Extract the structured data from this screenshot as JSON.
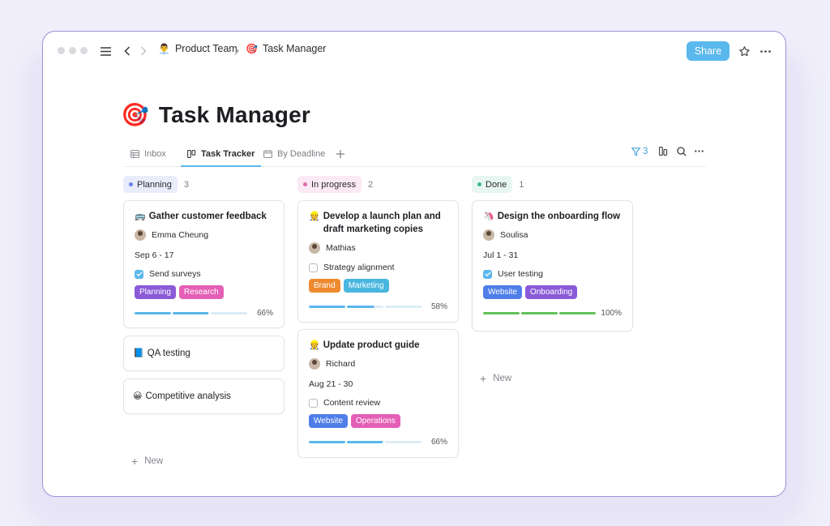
{
  "header": {
    "breadcrumb": [
      {
        "label": "Product Team",
        "emoji": "👨‍💼"
      },
      {
        "label": "Task Manager",
        "emoji": "🎯"
      }
    ],
    "share_label": "Share"
  },
  "page": {
    "title": "Task Manager",
    "emoji": "🎯"
  },
  "tabs": [
    {
      "label": "Inbox",
      "icon": "table-icon"
    },
    {
      "label": "Task Tracker",
      "icon": "board-icon",
      "active": true
    },
    {
      "label": "By Deadline",
      "icon": "calendar-icon"
    }
  ],
  "filter": {
    "count": "3"
  },
  "columns": [
    {
      "label": "Planning",
      "count": "3",
      "bg": "#e9ecfb",
      "dot": "#6a84e8",
      "cards": [
        {
          "title": "Gather customer feedback",
          "emoji": "🚌",
          "assignee": "Emma Cheung",
          "date": "Sep 6 - 17",
          "checklist": {
            "label": "Send surveys",
            "checked": true
          },
          "tags": [
            {
              "label": "Planning",
              "color": "#8a5ad8"
            },
            {
              "label": "Research",
              "color": "#e45fb5"
            }
          ],
          "progress_pct": "66%",
          "progress_color": "#5ab8ec",
          "progress": 0.66
        },
        {
          "title": "QA testing",
          "emoji": "📘"
        },
        {
          "title": "Competitive analysis",
          "emoji": "😀"
        }
      ],
      "new_label": "New"
    },
    {
      "label": "In progress",
      "count": "2",
      "bg": "#fbe9f4",
      "dot": "#e06aa9",
      "cards": [
        {
          "title": "Develop a launch plan and draft marketing copies",
          "emoji": "👷",
          "assignee": "Mathias",
          "checklist": {
            "label": "Strategy alignment",
            "checked": false
          },
          "tags": [
            {
              "label": "Brand",
              "color": "#ef8a2f"
            },
            {
              "label": "Marketing",
              "color": "#49b6df"
            }
          ],
          "progress_pct": "58%",
          "progress_color": "#5ab8ec",
          "progress": 0.58
        },
        {
          "title": "Update product guide",
          "emoji": "👷",
          "assignee": "Richard",
          "date": "Aug 21 - 30",
          "checklist": {
            "label": "Content review",
            "checked": false
          },
          "tags": [
            {
              "label": "Website",
              "color": "#4f7ee8"
            },
            {
              "label": "Operations",
              "color": "#e45fb5"
            }
          ],
          "progress_pct": "66%",
          "progress_color": "#5ab8ec",
          "progress": 0.66
        }
      ]
    },
    {
      "label": "Done",
      "count": "1",
      "bg": "#e7f6f1",
      "dot": "#3fb78b",
      "cards": [
        {
          "title": "Design the onboarding flow",
          "emoji": "🦄",
          "assignee": "Soulisa",
          "date": "Jul 1 - 31",
          "checklist": {
            "label": "User testing",
            "checked": true
          },
          "tags": [
            {
              "label": "Website",
              "color": "#4f7ee8"
            },
            {
              "label": "Onboarding",
              "color": "#8a5ad8"
            }
          ],
          "progress_pct": "100%",
          "progress_color": "#62c15a",
          "progress": 1.0
        }
      ],
      "new_label": "New"
    }
  ],
  "colors": {
    "accent": "#5ab8ec",
    "window_border": "#a48ed6"
  }
}
